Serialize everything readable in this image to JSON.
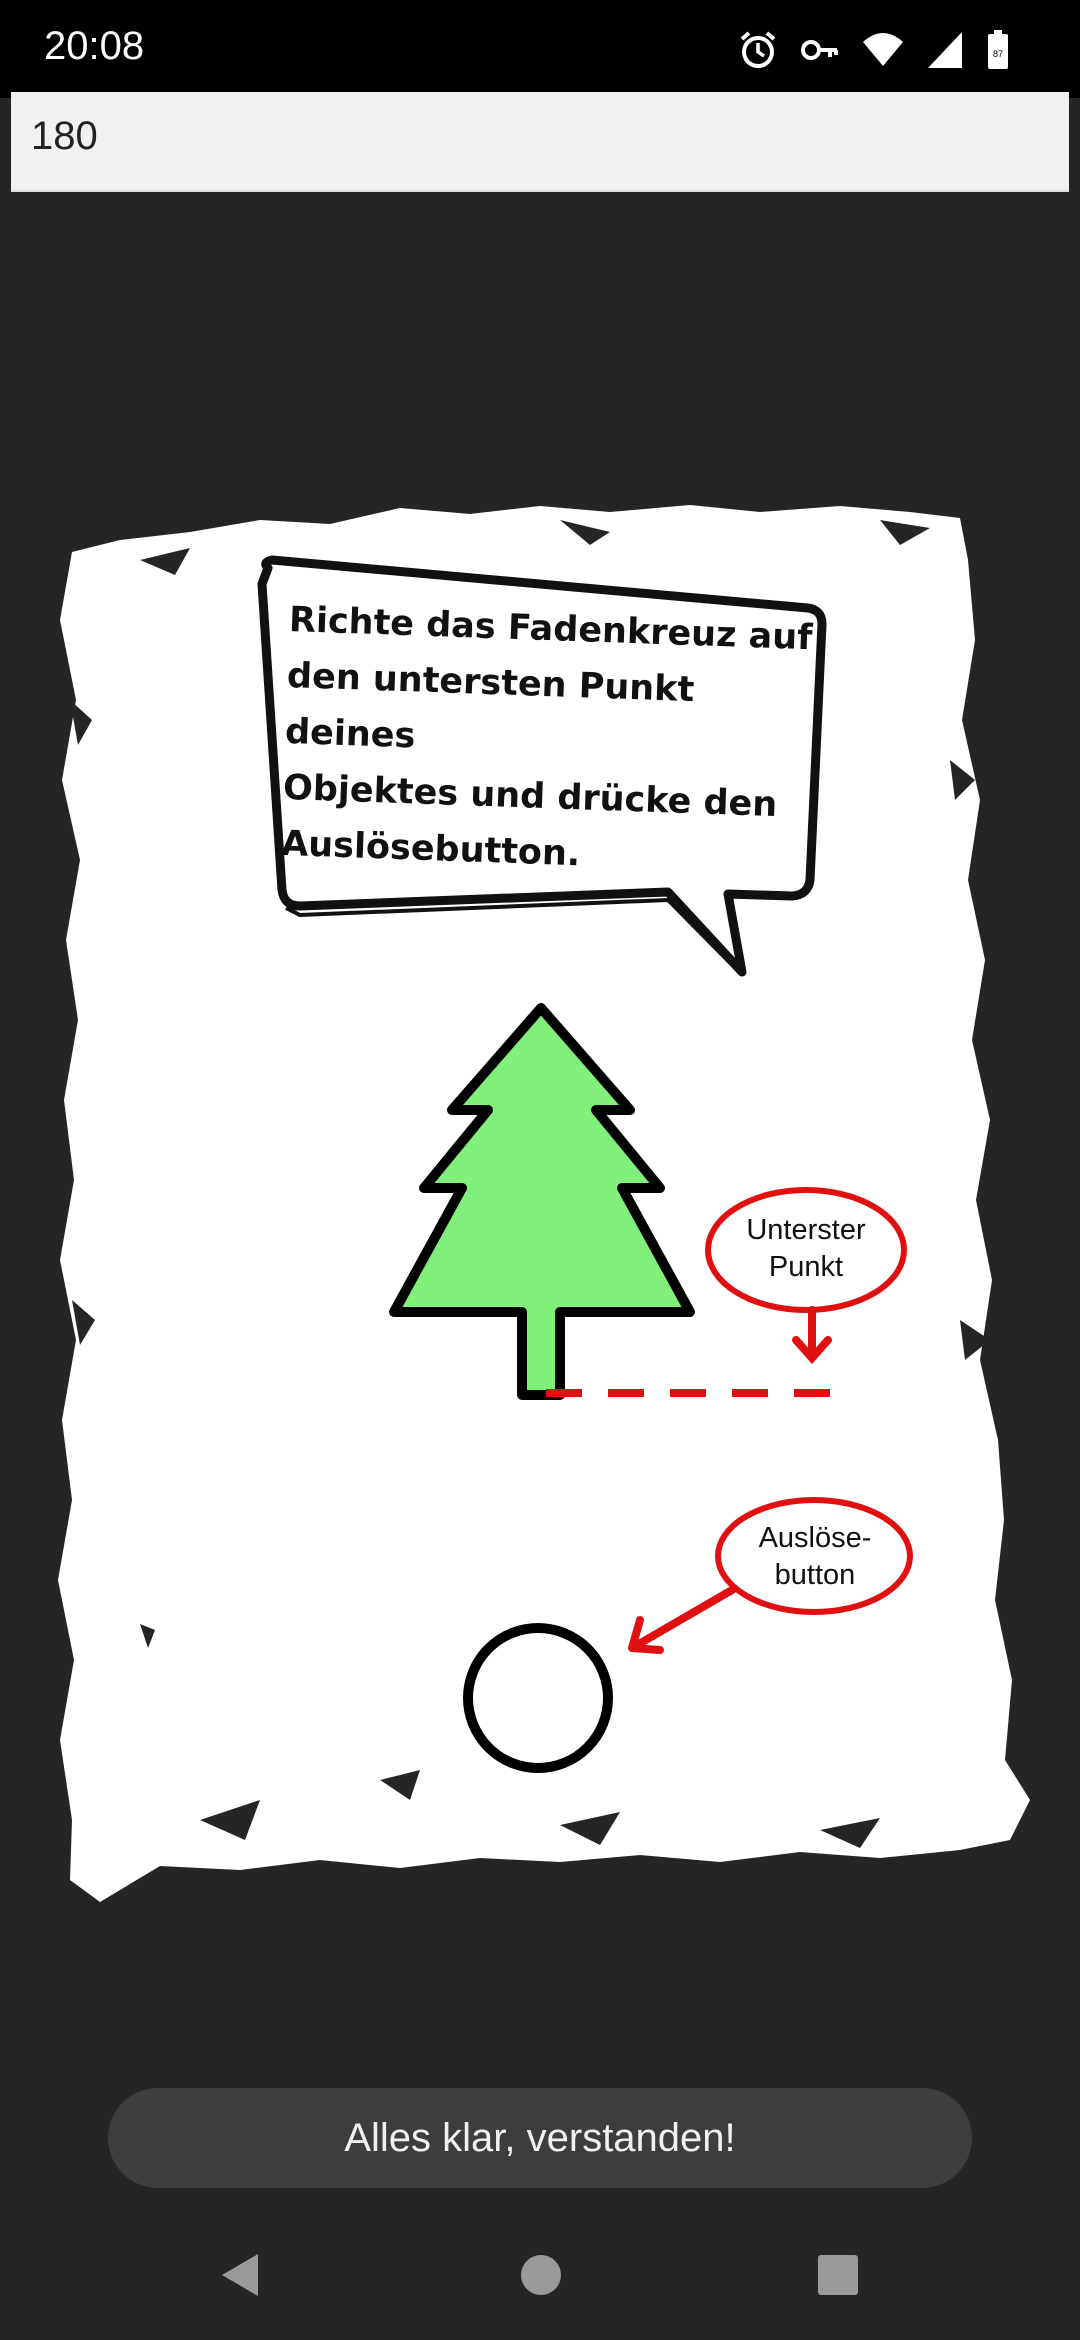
{
  "status": {
    "time": "20:08",
    "battery": "87",
    "icons": [
      "alarm-icon",
      "key-icon",
      "wifi-icon",
      "signal-icon",
      "battery-icon"
    ]
  },
  "input": {
    "value": "180"
  },
  "tutorial": {
    "speech_lines": [
      "Richte das Fadenkreuz auf",
      "den untersten Punkt deines",
      "Objektes und drücke den",
      "Auslösebutton."
    ],
    "label_bottom_point_line1": "Unterster",
    "label_bottom_point_line2": "Punkt",
    "label_trigger_line1": "Auslöse-",
    "label_trigger_line2": "button",
    "colors": {
      "tree_fill": "#80f07a",
      "marker_red": "#e11010"
    }
  },
  "confirm": {
    "label": "Alles klar, verstanden!"
  },
  "nav": {
    "icons": [
      "back-icon",
      "home-icon",
      "recents-icon"
    ]
  }
}
